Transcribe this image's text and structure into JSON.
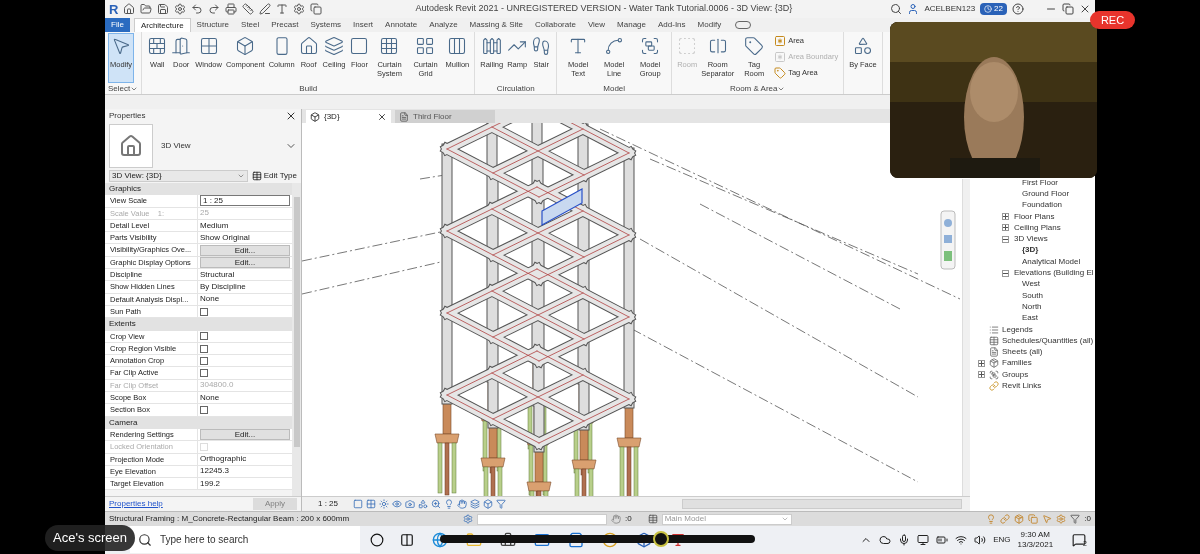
{
  "title_bar": {
    "logo": "R",
    "title": "Autodesk Revit 2021 - UNREGISTERED VERSION - Water Tank Tutorial.0006 - 3D View: {3D}",
    "user": "ACELBEN123",
    "badge": "22"
  },
  "ribbon_tabs": [
    {
      "label": "File",
      "kind": "menu",
      "selected": false
    },
    {
      "label": "Architecture",
      "kind": "tab",
      "selected": true
    },
    {
      "label": "Structure",
      "kind": "tab",
      "selected": false
    },
    {
      "label": "Steel",
      "kind": "tab",
      "selected": false
    },
    {
      "label": "Precast",
      "kind": "tab",
      "selected": false
    },
    {
      "label": "Systems",
      "kind": "tab",
      "selected": false
    },
    {
      "label": "Insert",
      "kind": "tab",
      "selected": false
    },
    {
      "label": "Annotate",
      "kind": "tab",
      "selected": false
    },
    {
      "label": "Analyze",
      "kind": "tab",
      "selected": false
    },
    {
      "label": "Massing & Site",
      "kind": "tab",
      "selected": false
    },
    {
      "label": "Collaborate",
      "kind": "tab",
      "selected": false
    },
    {
      "label": "View",
      "kind": "tab",
      "selected": false
    },
    {
      "label": "Manage",
      "kind": "tab",
      "selected": false
    },
    {
      "label": "Add-Ins",
      "kind": "tab",
      "selected": false
    },
    {
      "label": "Modify",
      "kind": "tab",
      "selected": false
    }
  ],
  "ribbon_panels": [
    {
      "title": "Select",
      "dropdown": true,
      "tools": [
        {
          "label": "Modify",
          "kind": "large",
          "selected": true,
          "disabled": false
        }
      ]
    },
    {
      "title": "Build",
      "dropdown": false,
      "tools": [
        {
          "label": "Wall",
          "kind": "large",
          "selected": false,
          "disabled": false
        },
        {
          "label": "Door",
          "kind": "large",
          "selected": false,
          "disabled": false
        },
        {
          "label": "Window",
          "kind": "large",
          "selected": false,
          "disabled": false
        },
        {
          "label": "Component",
          "kind": "large",
          "selected": false,
          "disabled": false
        },
        {
          "label": "Column",
          "kind": "large",
          "selected": false,
          "disabled": false
        },
        {
          "label": "Roof",
          "kind": "large",
          "selected": false,
          "disabled": false
        },
        {
          "label": "Ceiling",
          "kind": "large",
          "selected": false,
          "disabled": false
        },
        {
          "label": "Floor",
          "kind": "large",
          "selected": false,
          "disabled": false
        },
        {
          "label": "Curtain System",
          "kind": "large",
          "selected": false,
          "disabled": false
        },
        {
          "label": "Curtain Grid",
          "kind": "large",
          "selected": false,
          "disabled": false
        },
        {
          "label": "Mullion",
          "kind": "large",
          "selected": false,
          "disabled": false
        }
      ]
    },
    {
      "title": "Circulation",
      "dropdown": false,
      "tools": [
        {
          "label": "Railing",
          "kind": "large",
          "selected": false,
          "disabled": false
        },
        {
          "label": "Ramp",
          "kind": "large",
          "selected": false,
          "disabled": false
        },
        {
          "label": "Stair",
          "kind": "large",
          "selected": false,
          "disabled": false
        }
      ]
    },
    {
      "title": "Model",
      "dropdown": false,
      "tools": [
        {
          "label": "Model Text",
          "kind": "large",
          "selected": false,
          "disabled": false
        },
        {
          "label": "Model Line",
          "kind": "large",
          "selected": false,
          "disabled": false
        },
        {
          "label": "Model Group",
          "kind": "large",
          "selected": false,
          "disabled": false
        }
      ]
    },
    {
      "title": "Room & Area",
      "dropdown": true,
      "tools": [
        {
          "label": "Room",
          "kind": "large",
          "selected": false,
          "disabled": true
        },
        {
          "label": "Room Separator",
          "kind": "large",
          "selected": false,
          "disabled": false
        },
        {
          "label": "Tag Room",
          "kind": "large",
          "selected": false,
          "disabled": false
        },
        {
          "label": "Area",
          "kind": "small",
          "selected": false,
          "disabled": false
        },
        {
          "label": "Area Boundary",
          "kind": "small",
          "selected": false,
          "disabled": true
        },
        {
          "label": "Tag Area",
          "kind": "small",
          "selected": false,
          "disabled": false
        }
      ]
    },
    {
      "tools": [
        {
          "label": "By Face",
          "kind": "large",
          "selected": false,
          "disabled": false
        }
      ]
    }
  ],
  "properties": {
    "title": "Properties",
    "type_name": "3D View",
    "selector": "3D View: {3D}",
    "edit_type": "Edit Type",
    "groups": [
      {
        "title": "Graphics",
        "rows": [
          {
            "label": "View Scale",
            "value": "1 : 25",
            "kind": "field",
            "disabled": false
          },
          {
            "label": "Scale Value    1:",
            "value": "25",
            "kind": "text",
            "disabled": true
          },
          {
            "label": "Detail Level",
            "value": "Medium",
            "kind": "text",
            "disabled": false
          },
          {
            "label": "Parts Visibility",
            "value": "Show Original",
            "kind": "text",
            "disabled": false
          },
          {
            "label": "Visibility/Graphics Ove...",
            "value": "Edit...",
            "kind": "button",
            "disabled": false
          },
          {
            "label": "Graphic Display Options",
            "value": "Edit...",
            "kind": "button",
            "disabled": false
          },
          {
            "label": "Discipline",
            "value": "Structural",
            "kind": "text",
            "disabled": false
          },
          {
            "label": "Show Hidden Lines",
            "value": "By Discipline",
            "kind": "text",
            "disabled": false
          },
          {
            "label": "Default Analysis Displ...",
            "value": "None",
            "kind": "text",
            "disabled": false
          },
          {
            "label": "Sun Path",
            "kind": "checkbox",
            "checked": false,
            "disabled": false
          }
        ]
      },
      {
        "title": "Extents",
        "rows": [
          {
            "label": "Crop View",
            "kind": "checkbox",
            "checked": false,
            "disabled": false
          },
          {
            "label": "Crop Region Visible",
            "kind": "checkbox",
            "checked": false,
            "disabled": false
          },
          {
            "label": "Annotation Crop",
            "kind": "checkbox",
            "checked": false,
            "disabled": false
          },
          {
            "label": "Far Clip Active",
            "kind": "checkbox",
            "checked": false,
            "disabled": false
          },
          {
            "label": "Far Clip Offset",
            "value": "304800.0",
            "kind": "text",
            "disabled": true
          },
          {
            "label": "Scope Box",
            "value": "None",
            "kind": "text",
            "disabled": false
          },
          {
            "label": "Section Box",
            "kind": "checkbox",
            "checked": false,
            "disabled": false
          }
        ]
      },
      {
        "title": "Camera",
        "rows": [
          {
            "label": "Rendering Settings",
            "value": "Edit...",
            "kind": "button",
            "disabled": false
          },
          {
            "label": "Locked Orientation",
            "kind": "checkbox",
            "checked": false,
            "disabled": true
          },
          {
            "label": "Projection Mode",
            "value": "Orthographic",
            "kind": "text",
            "disabled": false
          },
          {
            "label": "Eye Elevation",
            "value": "12245.3",
            "kind": "text",
            "disabled": false
          },
          {
            "label": "Target Elevation",
            "value": "199.2",
            "kind": "text",
            "disabled": false
          }
        ]
      }
    ],
    "help_link": "Properties help",
    "apply": {
      "label": "Apply",
      "disabled": true
    }
  },
  "view_tabs": [
    {
      "label": "{3D}",
      "selected": true
    },
    {
      "label": "Third Floor",
      "selected": false
    }
  ],
  "view_scale": "1 : 25",
  "project_browser": {
    "cut_off_children": [
      {
        "label": "First Floor"
      },
      {
        "label": "Ground Floor"
      },
      {
        "label": "Foundation"
      }
    ],
    "view_nodes": [
      {
        "label": "Floor Plans",
        "expanded": false
      },
      {
        "label": "Ceiling Plans",
        "expanded": false
      },
      {
        "label": "3D Views",
        "expanded": true,
        "children": [
          {
            "label": "{3D}",
            "current": true
          },
          {
            "label": "Analytical Model",
            "current": false
          }
        ]
      },
      {
        "label": "Elevations (Building El",
        "expanded": true,
        "children": [
          {
            "label": "West",
            "current": false
          },
          {
            "label": "South",
            "current": false
          },
          {
            "label": "North",
            "current": false
          },
          {
            "label": "East",
            "current": false
          }
        ]
      }
    ],
    "top_nodes": [
      {
        "label": "Legends"
      },
      {
        "label": "Schedules/Quantities (all)"
      },
      {
        "label": "Sheets (all)"
      },
      {
        "label": "Families",
        "expanded": false
      },
      {
        "label": "Groups",
        "expanded": false
      },
      {
        "label": "Revit Links"
      }
    ]
  },
  "status_bar": {
    "text": "Structural Framing : M_Concrete-Rectangular Beam : 200 x 600mm",
    "workset_count": ":0",
    "model": "Main Model",
    "filter_count": ":0"
  },
  "taskbar": {
    "search_placeholder": "Type here to search",
    "language": "ENG",
    "time": "9:30 AM",
    "date": "13/3/2021",
    "notifications": "2"
  },
  "playback_bar": {
    "level": 0.7
  },
  "overlays": {
    "screen_label": "Ace's screen",
    "rec": "REC"
  }
}
